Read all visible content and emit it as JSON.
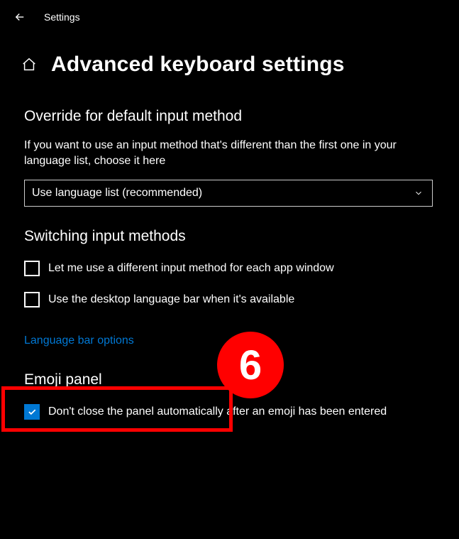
{
  "topbar": {
    "title": "Settings"
  },
  "header": {
    "title": "Advanced keyboard settings"
  },
  "sections": {
    "override": {
      "title": "Override for default input method",
      "description": "If you want to use an input method that's different than the first one in your language list, choose it here",
      "dropdown_value": "Use language list (recommended)"
    },
    "switching": {
      "title": "Switching input methods",
      "checkbox1_label": "Let me use a different input method for each app window",
      "checkbox2_label": "Use the desktop language bar when it's available",
      "link_label": "Language bar options"
    },
    "emoji": {
      "title": "Emoji panel",
      "checkbox_label": "Don't close the panel automatically after an emoji has been entered"
    }
  },
  "annotation": {
    "badge": "6"
  }
}
